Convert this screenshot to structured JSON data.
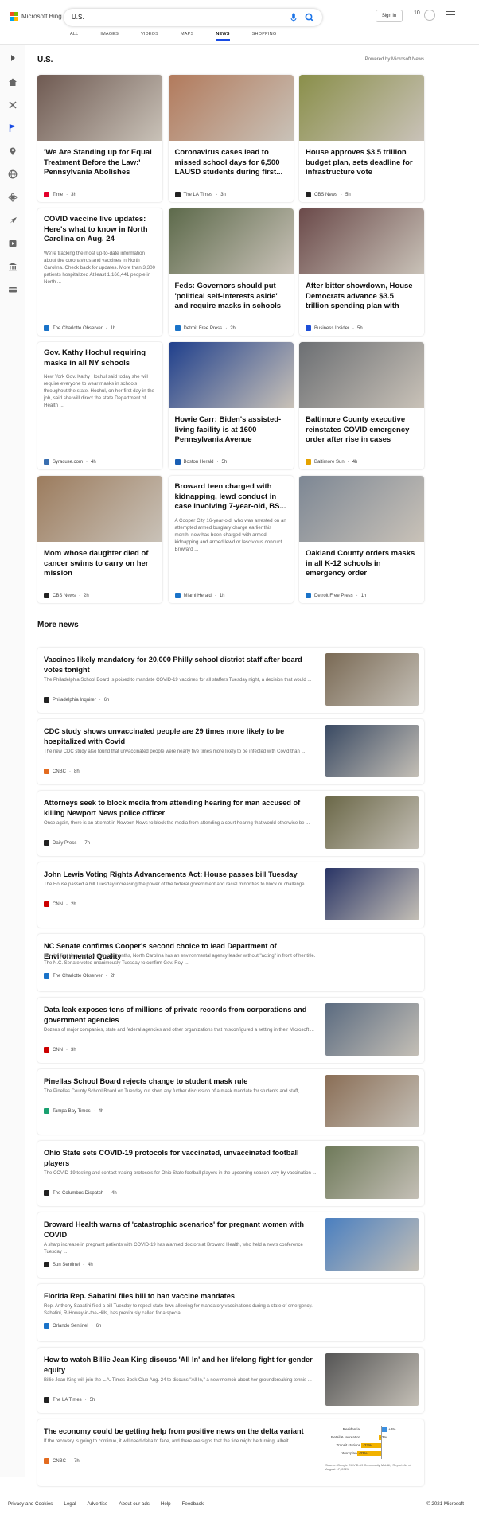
{
  "header": {
    "brand": "Microsoft Bing",
    "search_value": "U.S.",
    "signin_label": "Sign in",
    "rewards_count": "10",
    "tabs": [
      "ALL",
      "IMAGES",
      "VIDEOS",
      "MAPS",
      "NEWS",
      "SHOPPING"
    ],
    "active_tab": "NEWS",
    "brand_colors": [
      "#f25022",
      "#7fba00",
      "#00a4ef",
      "#ffb900"
    ]
  },
  "sidebar": {
    "icons": [
      "expand-icon",
      "home-icon",
      "sports-icon",
      "flag-icon",
      "location-icon",
      "world-icon",
      "science-icon",
      "tech-icon",
      "entertainment-icon",
      "politics-icon",
      "money-icon"
    ]
  },
  "section": {
    "title": "U.S.",
    "powered_by": "Powered by Microsoft News"
  },
  "cards": [
    {
      "title": "'We Are Standing up for Equal Treatment Before the Law:' Pennsylvania Abolishes Priso...",
      "desc": "",
      "source": "Time",
      "age": "3h",
      "src_color": "#e4002b",
      "img": "#6f5a52"
    },
    {
      "title": "Coronavirus cases lead to missed school days for 6,500 LAUSD students during first...",
      "desc": "",
      "source": "The LA Times",
      "age": "3h",
      "src_color": "#222",
      "img": "#b27a5c"
    },
    {
      "title": "House approves $3.5 trillion budget plan, sets deadline for infrastructure vote",
      "desc": "",
      "source": "CBS News",
      "age": "5h",
      "src_color": "#222",
      "img": "#8a8f4a"
    },
    {
      "title": "COVID vaccine live updates: Here's what to know in North Carolina on Aug. 24",
      "desc": "We're tracking the most up-to-date information about the coronavirus and vaccines in North Carolina. Check back for updates. More than 3,300 patients hospitalized At least 1,166,441 people in North ...",
      "source": "The Charlotte Observer",
      "age": "1h",
      "src_color": "#1a73c8",
      "img": ""
    },
    {
      "title": "Feds: Governors should put 'political self-interests aside' and require masks in schools",
      "desc": "",
      "source": "Detroit Free Press",
      "age": "2h",
      "src_color": "#1a73c8",
      "img": "#5d6a4b"
    },
    {
      "title": "After bitter showdown, House Democrats advance $3.5 trillion spending plan with Biden chil...",
      "desc": "",
      "source": "Business Insider",
      "age": "5h",
      "src_color": "#1d4fd8",
      "img": "#6b4a4a"
    },
    {
      "title": "Gov. Kathy Hochul requiring masks in all NY schools",
      "desc": "New York Gov. Kathy Hochul said today she will require everyone to wear masks in schools throughout the state. Hochul, on her first day in the job, said she will direct the state Department of Health ...",
      "source": "Syracuse.com",
      "age": "4h",
      "src_color": "#3a6fb0",
      "img": ""
    },
    {
      "title": "Howie Carr: Biden's assisted-living facility is at 1600 Pennsylvania Avenue",
      "desc": "",
      "source": "Boston Herald",
      "age": "5h",
      "src_color": "#1a5fb4",
      "img": "#1f3f8c"
    },
    {
      "title": "Baltimore County executive reinstates COVID emergency order after rise in cases",
      "desc": "",
      "source": "Baltimore Sun",
      "age": "4h",
      "src_color": "#e5a300",
      "img": "#6c6f73"
    },
    {
      "title": "Mom whose daughter died of cancer swims to carry on her mission",
      "desc": "",
      "source": "CBS News",
      "age": "2h",
      "src_color": "#222",
      "img": "#9c7c5e"
    },
    {
      "title": "Broward teen charged with kidnapping, lewd conduct in case involving 7-year-old, BS...",
      "desc": "A Cooper City 16-year-old, who was arrested on an attempted armed burglary charge earlier this month, now has been charged with armed kidnapping and armed lewd or lascivious conduct. Broward ...",
      "source": "Miami Herald",
      "age": "1h",
      "src_color": "#1a73c8",
      "img": ""
    },
    {
      "title": "Oakland County orders masks in all K-12 schools in emergency order",
      "desc": "",
      "source": "Detroit Free Press",
      "age": "1h",
      "src_color": "#1a73c8",
      "img": "#7d8794"
    }
  ],
  "more_news": {
    "title": "More news",
    "items": [
      {
        "title": "Vaccines likely mandatory for 20,000 Philly school district staff after board votes tonight",
        "desc": "The Philadelphia School Board is poised to mandate COVID-19 vaccines for all staffers Tuesday night, a decision that would ...",
        "source": "Philadelphia Inquirer",
        "age": "6h",
        "src_color": "#222",
        "img": "#7a6a55"
      },
      {
        "title": "CDC study shows unvaccinated people are 29 times more likely to be hospitalized with Covid",
        "desc": "The new CDC study also found that unvaccinated people were nearly five times more likely to be infected with Covid than ...",
        "source": "CNBC",
        "age": "8h",
        "src_color": "#e36b1f",
        "img": "#3a4a63"
      },
      {
        "title": "Attorneys seek to block media from attending hearing for man accused of killing Newport News police officer",
        "desc": "Once again, there is an attempt in Newport News to block the media from attending a court hearing that would otherwise be ...",
        "source": "Daily Press",
        "age": "7h",
        "src_color": "#222",
        "img": "#6b6848"
      },
      {
        "title": "John Lewis Voting Rights Advancements Act: House passes bill Tuesday",
        "desc": "The House passed a bill Tuesday increasing the power of the federal government and racial minorities to block or challenge ...",
        "source": "CNN",
        "age": "2h",
        "src_color": "#cc0000",
        "img": "#2a3566"
      },
      {
        "title": "NC Senate confirms Cooper's second choice to lead Department of Environmental Quality",
        "desc": "For the first time in more than six months, North Carolina has an environmental agency leader without \"acting\" in front of her title. The N.C. Senate voted unanimously Tuesday to confirm Gov. Roy ...",
        "source": "The Charlotte Observer",
        "age": "2h",
        "src_color": "#1a73c8",
        "img": ""
      },
      {
        "title": "Data leak exposes tens of millions of private records from corporations and government agencies",
        "desc": "Dozens of major companies, state and federal agencies and other organizations that misconfigured a setting in their Microsoft ...",
        "source": "CNN",
        "age": "3h",
        "src_color": "#cc0000",
        "img": "#5b6b80"
      },
      {
        "title": "Pinellas School Board rejects change to student mask rule",
        "desc": "The Pinellas County School Board on Tuesday out short any further discussion of a mask mandate for students and staff, ...",
        "source": "Tampa Bay Times",
        "age": "4h",
        "src_color": "#1aa070",
        "img": "#8a6e56"
      },
      {
        "title": "Ohio State sets COVID-19 protocols for vaccinated, unvaccinated football players",
        "desc": "The COVID-19 testing and contact tracing protocols for Ohio State football players in the upcoming season vary by vaccination ...",
        "source": "The Columbus Dispatch",
        "age": "4h",
        "src_color": "#222",
        "img": "#6f7a5a"
      },
      {
        "title": "Broward Health warns of 'catastrophic scenarios' for pregnant women with COVID",
        "desc": "A sharp increase in pregnant patients with COVID-19 has alarmed doctors at Broward Health, who held a news conference Tuesday ...",
        "source": "Sun Sentinel",
        "age": "4h",
        "src_color": "#222",
        "img": "#4a7fc0"
      },
      {
        "title": "Florida Rep. Sabatini files bill to ban vaccine mandates",
        "desc": "Rep. Anthony Sabatini filed a bill Tuesday to repeal state laws allowing for mandatory vaccinations during a state of emergency. Sabatini, R-Howey-in-the-Hills, has previously called for a special ...",
        "source": "Orlando Sentinel",
        "age": "6h",
        "src_color": "#1a73c8",
        "img": ""
      },
      {
        "title": "How to watch Billie Jean King discuss 'All In' and her lifelong fight for gender equity",
        "desc": "Billie Jean King will join the L.A. Times Book Club Aug. 24 to discuss \"All In,\" a new memoir about her groundbreaking tennis ...",
        "source": "The LA Times",
        "age": "5h",
        "src_color": "#222",
        "img": "#555555"
      },
      {
        "title": "The economy could be getting help from positive news on the delta variant",
        "desc": "If the recovery is going to continue, it will need delta to fade, and there are signs that the tide might be turning, albeit ...",
        "source": "CNBC",
        "age": "7h",
        "src_color": "#e36b1f",
        "img": ""
      }
    ]
  },
  "mobility": {
    "rows": [
      {
        "label": "Residential",
        "value": "+8%",
        "num": 8,
        "color": "#3b8fe0"
      },
      {
        "label": "Retail & recreation",
        "value": "-3%",
        "num": -3,
        "color": "#f2b200"
      },
      {
        "label": "Transit stations",
        "value": "-27%",
        "num": -27,
        "color": "#f2b200"
      },
      {
        "label": "Workplaces",
        "value": "-33%",
        "num": -33,
        "color": "#f2b200"
      }
    ],
    "source_note": "Source: Google COVID-19 Community Mobility Report. As of August 17, 2021"
  },
  "footer": {
    "links": [
      "Privacy and Cookies",
      "Legal",
      "Advertise",
      "About our ads",
      "Help",
      "Feedback"
    ],
    "copyright": "© 2021 Microsoft"
  }
}
